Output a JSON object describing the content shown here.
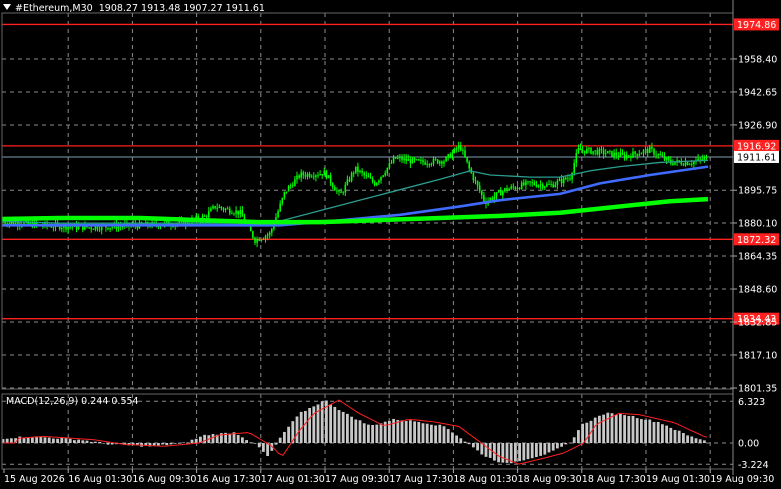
{
  "header": {
    "symbol": "#Ethereum,M30",
    "ohlc": "1908.27 1913.48 1907.27 1911.61"
  },
  "price_axis": {
    "ticks": [
      "1958.40",
      "1942.65",
      "1926.90",
      "1895.75",
      "1880.10",
      "1864.35",
      "1848.60",
      "1832.85",
      "1817.10",
      "1801.35"
    ],
    "current_price": "1911.61"
  },
  "levels": [
    {
      "label": "1974.86",
      "color": "#ff2020"
    },
    {
      "label": "1916.92",
      "color": "#ff2020"
    },
    {
      "label": "1872.32",
      "color": "#ff2020"
    },
    {
      "label": "1834.43",
      "color": "#ff2020"
    }
  ],
  "macd": {
    "label": "MACD(12,26,9) 0.244 0.554",
    "ticks": [
      "6.323",
      "0.00",
      "-3.224"
    ]
  },
  "time_axis": [
    "15 Aug 2026",
    "16 Aug 01:30",
    "16 Aug 09:30",
    "16 Aug 17:30",
    "17 Aug 01:30",
    "17 Aug 09:30",
    "17 Aug 17:30",
    "18 Aug 01:30",
    "18 Aug 09:30",
    "18 Aug 17:30",
    "19 Aug 01:30",
    "19 Aug 09:30"
  ],
  "colors": {
    "background": "#000000",
    "grid": "#8a8a8a",
    "candle": "#00ff00",
    "ma_fast": "#2a9d8f",
    "ma_mid": "#3f6bff",
    "ma_slow": "#00ff00",
    "macd_hist": "#c8c8c8",
    "macd_signal": "#ff2020",
    "current_line": "#7f9fb0"
  }
}
